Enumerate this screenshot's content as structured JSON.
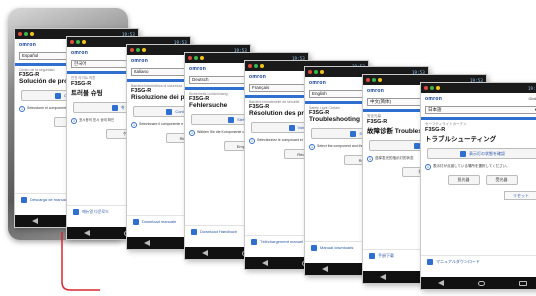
{
  "logo": "omron",
  "status_time": "19:53",
  "model": "F3SG-R",
  "nav_top": "Global",
  "screens": [
    {
      "lang": "Español",
      "label": "Centro de la seguridad",
      "title": "Solución de problemas",
      "manual": "Consulte el manual",
      "instr": "Seleccione el componente e indicaciones pertinentes",
      "btn1": "Receptor",
      "btn2": "",
      "bottom": "Descarga de manuales"
    },
    {
      "lang": "한국어",
      "label": "안전 라이트 커튼",
      "title": "트러블 슈팅",
      "manual": "취 메뉴얼 참조",
      "instr": "표시등의 표시 상태 확인",
      "btn1": "수광기",
      "btn2": "",
      "bottom": "매뉴얼 다운로드"
    },
    {
      "lang": "Italiano",
      "label": "Barriera fotoelettrica di sicurezza",
      "title": "Risoluzione dei problemi",
      "manual": "Controlla il manuale",
      "instr": "Selezionare il componente e controllare la lampeggiante",
      "btn1": "Ricevitore",
      "btn2": "",
      "bottom": "Download manuale"
    },
    {
      "lang": "Deutsch",
      "label": "Sicherheits-Lichtvorhang",
      "title": "Fehlersuche",
      "manual": "Siehe Anzeigen",
      "instr": "Wählen Sie die Komponente und die Anzeigen",
      "btn1": "Empfänger",
      "btn2": "",
      "bottom": "Download Handbuch"
    },
    {
      "lang": "Français",
      "label": "Barrière immatérielle de sécurité",
      "title": "Résolution des problèmes",
      "manual": "Voir disposition",
      "instr": "Sélectionnez le composant et les voyants",
      "btn1": "Récepteur",
      "btn2": "",
      "bottom": "Téléchargement manuel"
    },
    {
      "lang": "English",
      "label": "Safety Light Curtain",
      "title": "Troubleshooting",
      "manual": "See indicator",
      "instr": "Select the component and the blinking",
      "btn1": "Receiver",
      "btn2": "",
      "bottom": "Manual downloads"
    },
    {
      "lang": "中文(简体)",
      "label": "安全光幕",
      "title": "故障诊断 Troubleshooting",
      "manual": "请参阅",
      "instr": "选择发光的指示灯的状态",
      "btn1": "接收器",
      "btn2": "",
      "bottom": "手册下载"
    },
    {
      "lang": "日本語",
      "label": "セーフティライトカーテン",
      "title": "トラブルシューティング",
      "manual": "表示灯の状態を確認",
      "instr": "表示灯が点滅している場所を選択してください。",
      "btn1": "投光器",
      "btn2": "受光器",
      "reset": "リセット",
      "bottom": "マニュアルダウンロード"
    }
  ]
}
